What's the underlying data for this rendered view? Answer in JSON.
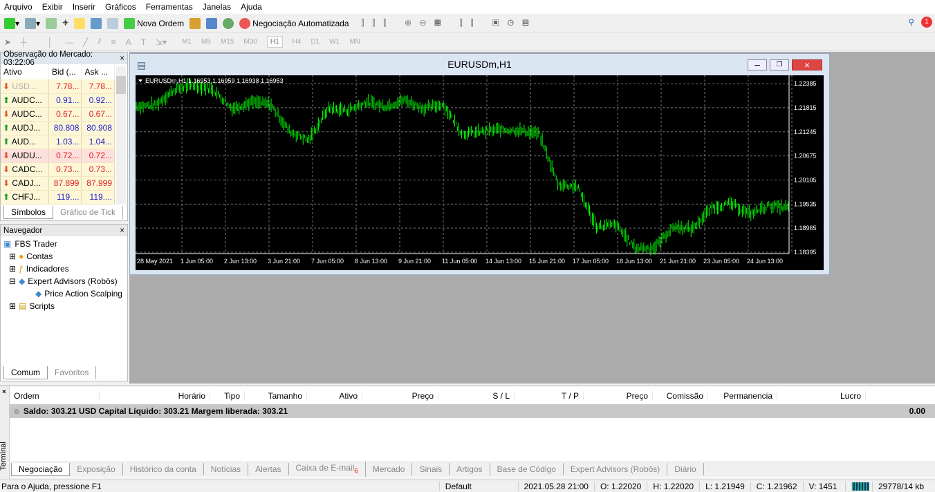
{
  "menu": [
    "Arquivo",
    "Exibir",
    "Inserir",
    "Gráficos",
    "Ferramentas",
    "Janelas",
    "Ajuda"
  ],
  "toolbar": {
    "new_order": "Nova Ordem",
    "auto_trading": "Negociação Automatizada",
    "notification_count": "1",
    "timeframes": [
      "M1",
      "M5",
      "M15",
      "M30",
      "H1",
      "H4",
      "D1",
      "W1",
      "MN"
    ],
    "active_timeframe": "H1"
  },
  "market_watch": {
    "title": "Observação do Mercado: 03:22:06",
    "columns": [
      "Ativo",
      "Bid (...",
      "Ask ..."
    ],
    "rows": [
      {
        "symbol": "USD...",
        "bid": "7.78...",
        "ask": "7.78...",
        "dir": "down",
        "color": "red",
        "dim": true
      },
      {
        "symbol": "AUDC...",
        "bid": "0.91...",
        "ask": "0.92...",
        "dir": "up",
        "color": "blue"
      },
      {
        "symbol": "AUDC...",
        "bid": "0.67...",
        "ask": "0.67...",
        "dir": "down",
        "color": "red"
      },
      {
        "symbol": "AUDJ...",
        "bid": "80.808",
        "ask": "80.908",
        "dir": "up",
        "color": "blue"
      },
      {
        "symbol": "AUD...",
        "bid": "1.03...",
        "ask": "1.04...",
        "dir": "up",
        "color": "blue"
      },
      {
        "symbol": "AUDU...",
        "bid": "0.72...",
        "ask": "0.72...",
        "dir": "down",
        "color": "red",
        "highlight": true
      },
      {
        "symbol": "CADC...",
        "bid": "0.73...",
        "ask": "0.73...",
        "dir": "down",
        "color": "red"
      },
      {
        "symbol": "CADJ...",
        "bid": "87.899",
        "ask": "87.999",
        "dir": "down",
        "color": "red"
      },
      {
        "symbol": "CHFJ...",
        "bid": "119....",
        "ask": "119....",
        "dir": "up",
        "color": "blue"
      }
    ],
    "tabs": [
      "Símbolos",
      "Gráfico de Tick"
    ]
  },
  "navigator": {
    "title": "Navegador",
    "root": "FBS Trader",
    "items": [
      "Contas",
      "Indicadores",
      "Expert Advisors (Robôs)"
    ],
    "ea_child": "Price Action Scalping",
    "scripts": "Scripts",
    "tabs": [
      "Comum",
      "Favoritos"
    ]
  },
  "chart": {
    "window_title": "EURUSDm,H1",
    "info": "EURUSDm,H1  1.16953 1.16959 1.16938 1.16953",
    "line_color": "#00ff00",
    "bg": "#000000",
    "chart_data": {
      "type": "bar",
      "ylim": [
        1.1833,
        1.2255
      ],
      "y_ticks": [
        "1.22385",
        "1.21815",
        "1.21245",
        "1.20675",
        "1.20105",
        "1.19535",
        "1.18965",
        "1.18395"
      ],
      "x_ticks": [
        "28 May 2021",
        "1 Jun 05:00",
        "2 Jun 13:00",
        "3 Jun 21:00",
        "7 Jun 05:00",
        "8 Jun 13:00",
        "9 Jun 21:00",
        "11 Jun 05:00",
        "14 Jun 13:00",
        "15 Jun 21:00",
        "17 Jun 05:00",
        "18 Jun 13:00",
        "21 Jun 21:00",
        "23 Jun 05:00",
        "24 Jun 13:00"
      ],
      "approx_closes": [
        1.2185,
        1.2188,
        1.2225,
        1.2235,
        1.2225,
        1.218,
        1.2195,
        1.219,
        1.2125,
        1.2105,
        1.218,
        1.2175,
        1.2195,
        1.2185,
        1.22,
        1.218,
        1.219,
        1.212,
        1.2125,
        1.213,
        1.2128,
        1.212,
        1.2,
        1.1995,
        1.19,
        1.1905,
        1.185,
        1.185,
        1.19,
        1.1895,
        1.1945,
        1.1955,
        1.193,
        1.195,
        1.1945
      ]
    }
  },
  "terminal": {
    "label": "Terminal",
    "columns": [
      "Ordem",
      "Horário",
      "Tipo",
      "Tamanho",
      "Ativo",
      "Preço",
      "S / L",
      "T / P",
      "Preço",
      "Comissão",
      "Permanencia",
      "Lucro"
    ],
    "balance": "Saldo: 303.21 USD  Capital Líquido: 303.21  Margem liberada: 303.21",
    "profit": "0.00",
    "tabs": [
      "Negociação",
      "Exposição",
      "Histórico da conta",
      "Notícias",
      "Alertas",
      "Caixa de E-mail",
      "Mercado",
      "Sinais",
      "Artigos",
      "Base de Código",
      "Expert Advisors (Robôs)",
      "Diário"
    ],
    "mail_badge": "6"
  },
  "status": {
    "help": "Para o Ajuda, pressione F1",
    "profile": "Default",
    "datetime": "2021.05.28 21:00",
    "open": "O: 1.22020",
    "high": "H: 1.22020",
    "low": "L: 1.21949",
    "close": "C: 1.21962",
    "volume": "V: 1451",
    "traffic": "29778/14 kb"
  }
}
